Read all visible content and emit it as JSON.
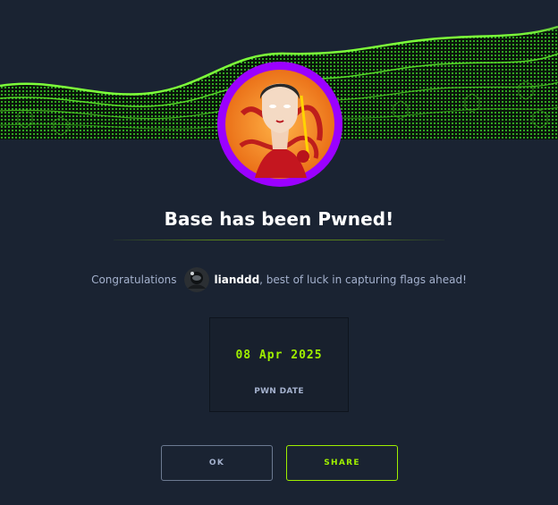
{
  "modal": {
    "title": "Base has been Pwned!",
    "congrats_prefix": "Congratulations",
    "username": "lianddd",
    "congrats_suffix": ", best of luck in capturing flags ahead!"
  },
  "stat": {
    "value": "08 Apr 2025",
    "label": "PWN DATE"
  },
  "buttons": {
    "ok_label": "OK",
    "share_label": "SHARE"
  },
  "icons": {
    "banner": "green-wireframe-wave-banner",
    "machine": "machine-avatar-icon",
    "user": "user-avatar-icon"
  },
  "colors": {
    "background": "#1a2332",
    "accent": "#9fef00",
    "avatar_ring": "#9b00ff",
    "muted_text": "#a4b1cd"
  }
}
